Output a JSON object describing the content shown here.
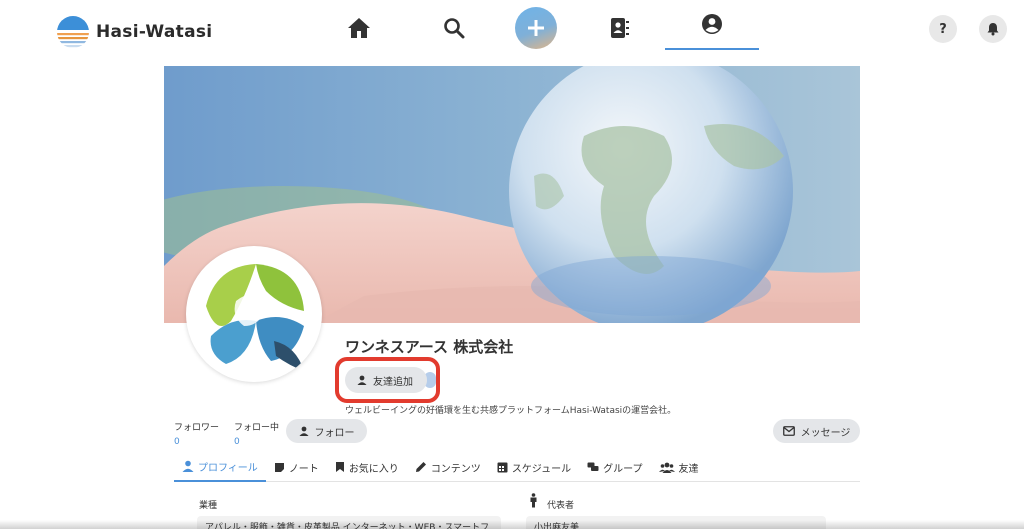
{
  "header": {
    "brand": "Hasi-Watasi",
    "help_label": "?",
    "nav": [
      {
        "icon": "home-icon"
      },
      {
        "icon": "search-icon"
      },
      {
        "icon": "plus-icon"
      },
      {
        "icon": "contacts-icon"
      },
      {
        "icon": "user-circle-icon",
        "active": true
      }
    ]
  },
  "profile": {
    "company_name": "ワンネスアース 株式会社",
    "friend_button": "友達追加",
    "description": "ウェルビーイングの好循環を生む共感プラットフォームHasi-Watasiの運営会社。",
    "followers_label": "フォロワー",
    "followers_count": "0",
    "following_label": "フォロー中",
    "following_count": "0",
    "follow_button": "フォロー",
    "message_button": "メッセージ"
  },
  "tabs": [
    {
      "label": "プロフィール",
      "icon": "user-icon",
      "active": true
    },
    {
      "label": "ノート",
      "icon": "note-icon"
    },
    {
      "label": "お気に入り",
      "icon": "bookmark-icon"
    },
    {
      "label": "コンテンツ",
      "icon": "pencil-icon"
    },
    {
      "label": "スケジュール",
      "icon": "calendar-icon"
    },
    {
      "label": "グループ",
      "icon": "chat-icon"
    },
    {
      "label": "友達",
      "icon": "users-icon"
    }
  ],
  "details": {
    "industry_label": "業種",
    "industry_value": "アパレル・服飾・雑貨・皮革製品 インターネット・WEB・スマートフ",
    "rep_label": "代表者",
    "rep_value": "小出麻友美"
  },
  "colors": {
    "accent": "#4a90d9",
    "highlight": "#e23b2e",
    "button_bg": "#e4e6e9"
  }
}
